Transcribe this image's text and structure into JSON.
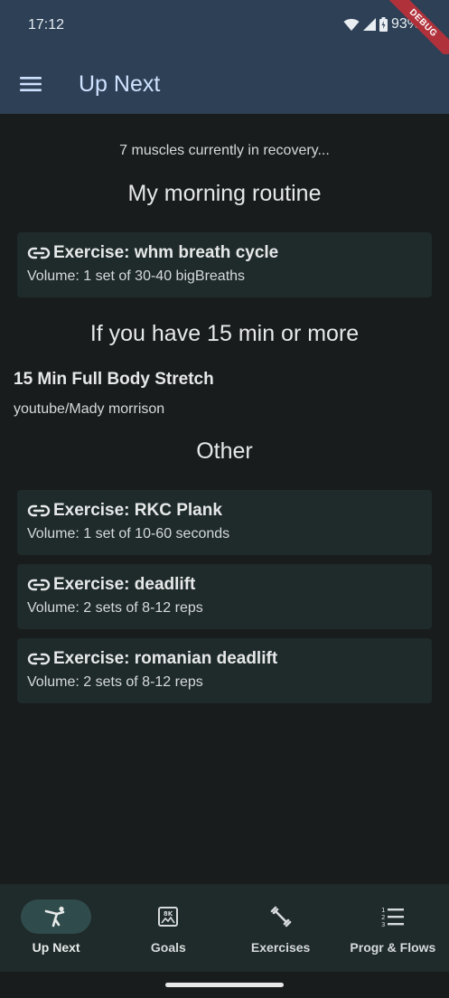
{
  "status_bar": {
    "time": "17:12",
    "battery": "93%"
  },
  "debug_banner": "DEBUG",
  "app_bar": {
    "title": "Up Next"
  },
  "recovery_text": "7 muscles currently in recovery...",
  "sections": {
    "morning": {
      "title": "My morning routine",
      "cards": [
        {
          "title": "Exercise: whm breath cycle",
          "volume": "Volume: 1 set of 30-40 bigBreaths"
        }
      ]
    },
    "fifteen": {
      "title": "If you have 15 min or more",
      "item": {
        "title": "15 Min Full Body Stretch",
        "subtitle": "youtube/Mady morrison"
      }
    },
    "other": {
      "title": "Other",
      "cards": [
        {
          "title": "Exercise: RKC Plank",
          "volume": "Volume: 1 set of 10-60 seconds"
        },
        {
          "title": "Exercise: deadlift",
          "volume": "Volume: 2 sets of 8-12 reps"
        },
        {
          "title": "Exercise: romanian deadlift",
          "volume": "Volume: 2 sets of 8-12 reps"
        }
      ]
    }
  },
  "bottom_nav": [
    {
      "label": "Up Next",
      "icon": "kick-figure-icon",
      "active": true
    },
    {
      "label": "Goals",
      "icon": "goal-badge-icon",
      "active": false
    },
    {
      "label": "Exercises",
      "icon": "dumbbell-icon",
      "active": false
    },
    {
      "label": "Progr & Flows",
      "icon": "numbered-list-icon",
      "active": false
    }
  ],
  "colors": {
    "app_bar": "#2d4055",
    "background": "#191c1d",
    "card": "#1f2a2a",
    "nav_active_pill": "#304b4b",
    "title_text": "#cfe2ff"
  }
}
